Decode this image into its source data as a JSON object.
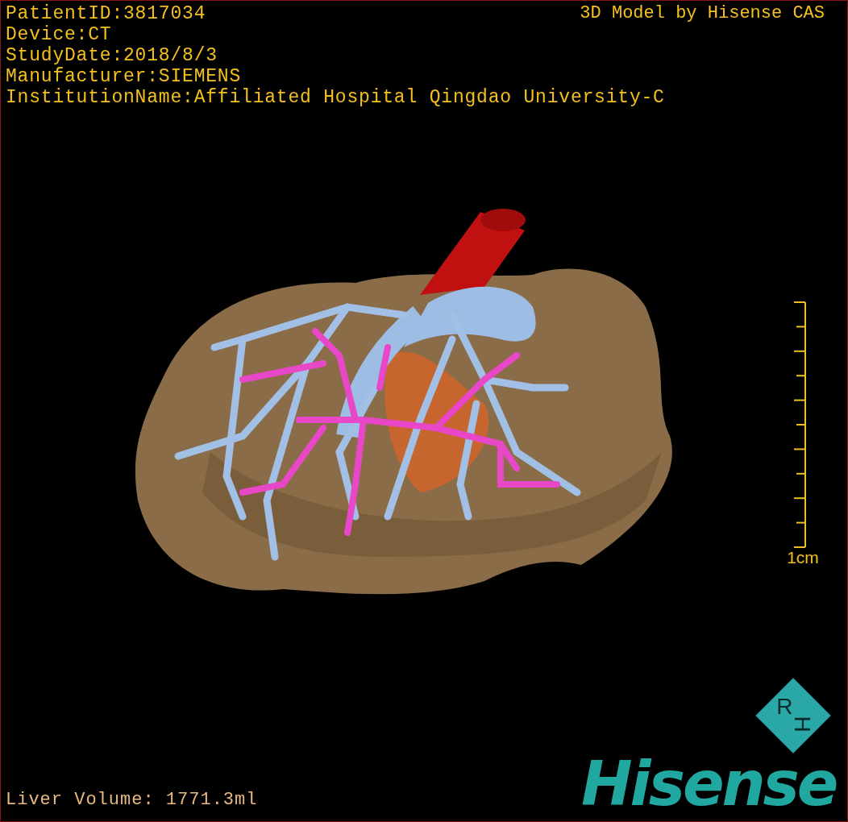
{
  "info_lines": [
    "PatientID:3817034",
    "Device:CT",
    "StudyDate:2018/8/3",
    "Manufacturer:SIEMENS",
    "InstitutionName:Affiliated Hospital Qingdao University-C"
  ],
  "credit": "3D Model by Hisense CAS",
  "scale_bar": {
    "label": "1cm"
  },
  "volume": "Liver Volume: 1771.3ml",
  "logo": {
    "cube_letters": [
      "R",
      "H"
    ],
    "text": "Hisense"
  }
}
